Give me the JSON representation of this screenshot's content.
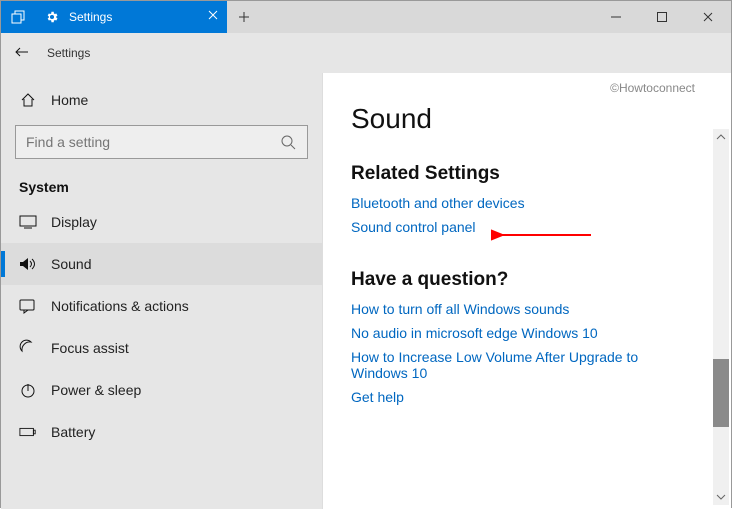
{
  "titlebar": {
    "tab_label": "Settings"
  },
  "subheader": {
    "title": "Settings"
  },
  "sidebar": {
    "home_label": "Home",
    "search_placeholder": "Find a setting",
    "category": "System",
    "items": [
      {
        "label": "Display"
      },
      {
        "label": "Sound"
      },
      {
        "label": "Notifications & actions"
      },
      {
        "label": "Focus assist"
      },
      {
        "label": "Power & sleep"
      },
      {
        "label": "Battery"
      }
    ]
  },
  "main": {
    "watermark": "©Howtoconnect",
    "title": "Sound",
    "related_heading": "Related Settings",
    "related_links": [
      "Bluetooth and other devices",
      "Sound control panel"
    ],
    "question_heading": "Have a question?",
    "question_links": [
      "How to turn off all Windows sounds",
      "No audio in microsoft edge Windows 10",
      "How to Increase Low Volume After Upgrade to Windows 10",
      "Get help"
    ]
  }
}
